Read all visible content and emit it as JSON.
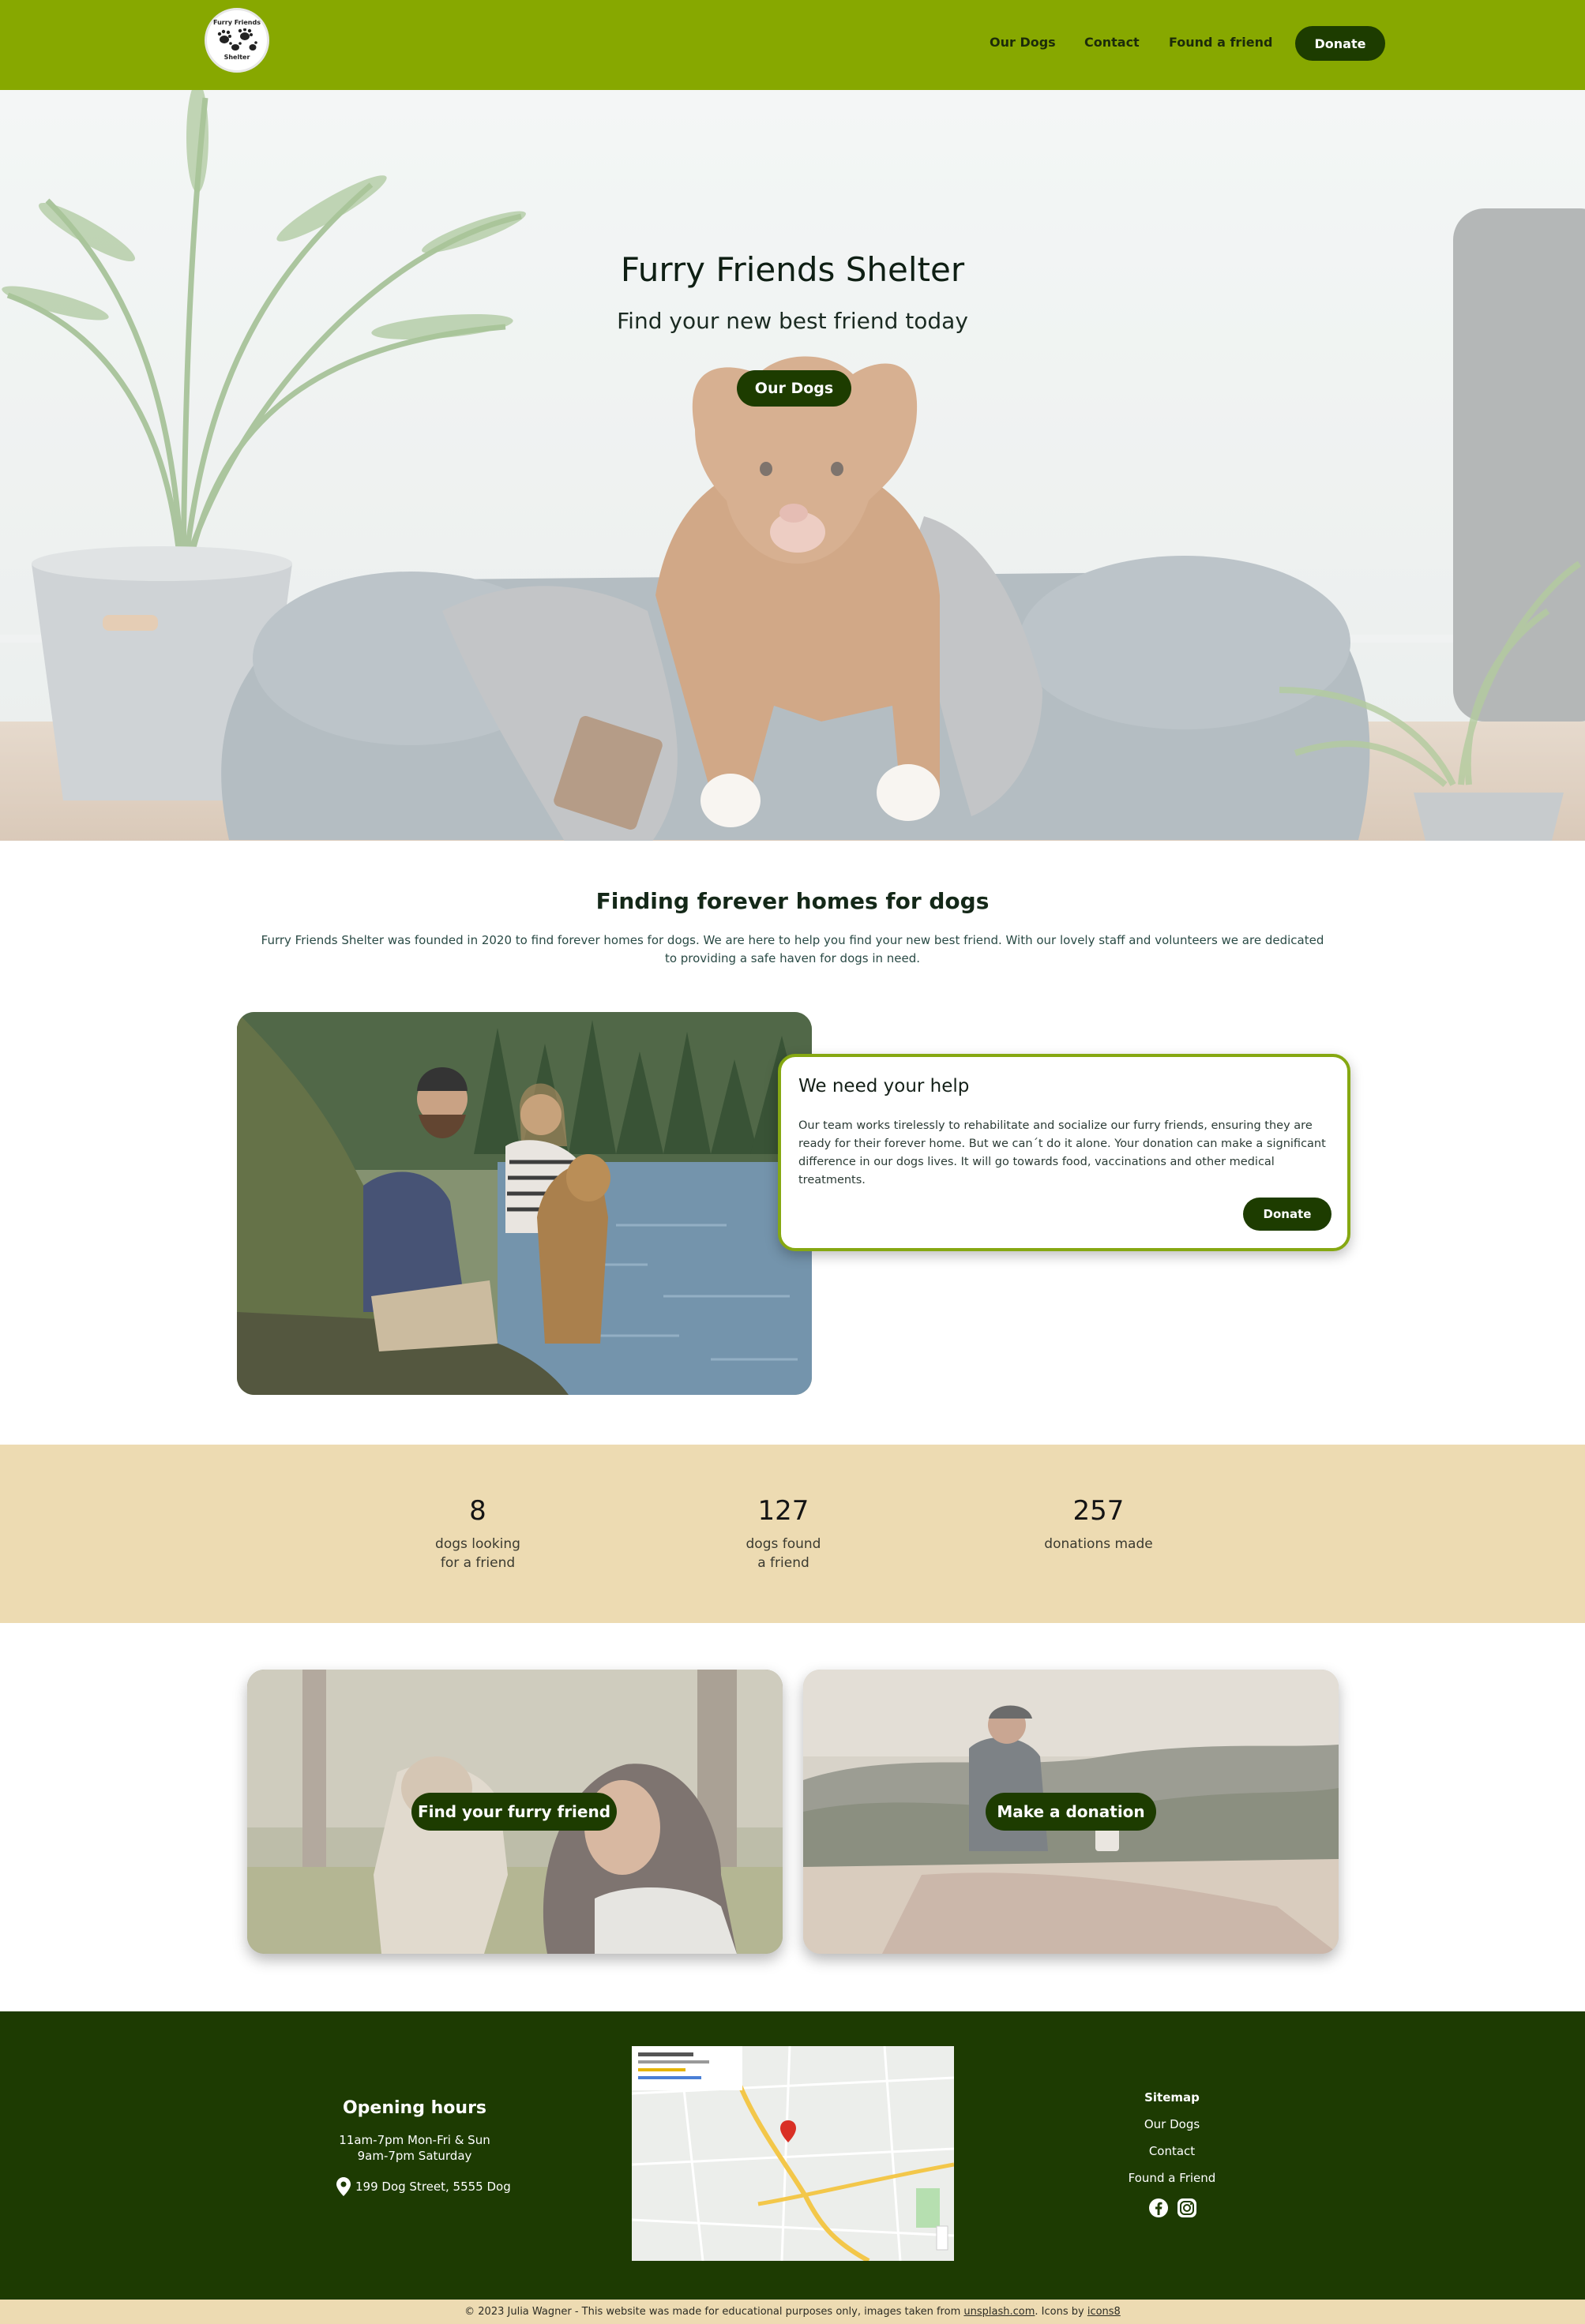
{
  "brand": {
    "logo_line1": "Furry Friends",
    "logo_line2": "Shelter"
  },
  "nav": {
    "links": [
      "Our Dogs",
      "Contact",
      "Found a friend"
    ],
    "donate": "Donate"
  },
  "hero": {
    "title": "Furry Friends Shelter",
    "subtitle": "Find your new best friend today",
    "button": "Our Dogs"
  },
  "intro": {
    "title": "Finding forever homes for dogs",
    "text": "Furry Friends Shelter was founded in 2020 to find forever homes for dogs. We are here to help you find your new best friend. With our lovely staff and volunteers we are dedicated to providing a safe haven for dogs in need."
  },
  "help": {
    "title": "We need your help",
    "text": "Our team works tirelessly to rehabilitate and socialize our furry friends, ensuring they are ready for their forever home. But we can´t do it alone. Your donation can make a significant difference in our dogs lives. It will go towards food, vaccinations and other medical treatments.",
    "button": "Donate"
  },
  "stats": [
    {
      "number": "8",
      "line1": "dogs looking",
      "line2": "for a friend"
    },
    {
      "number": "127",
      "line1": "dogs found",
      "line2": "a friend"
    },
    {
      "number": "257",
      "line1": "donations made",
      "line2": ""
    }
  ],
  "cta": {
    "left": "Find your furry friend",
    "right": "Make a donation"
  },
  "footer": {
    "hours_title": "Opening hours",
    "hours_line1": "11am-7pm Mon-Fri & Sun",
    "hours_line2": "9am-7pm Saturday",
    "address": "199 Dog Street, 5555 Dog",
    "sitemap_title": "Sitemap",
    "sitemap_links": [
      "Our Dogs",
      "Contact",
      "Found a Friend"
    ],
    "social_icons": [
      "facebook-icon",
      "instagram-icon"
    ]
  },
  "bottom": {
    "text": "© 2023 Julia Wagner - This website was made for educational purposes only, images taken from",
    "link1": "unsplash.com",
    "mid": ". Icons by",
    "link2": "icons8"
  },
  "colors": {
    "nav_green": "#87a800",
    "dark_green": "#1d3c00",
    "beige": "#eddbb2"
  }
}
